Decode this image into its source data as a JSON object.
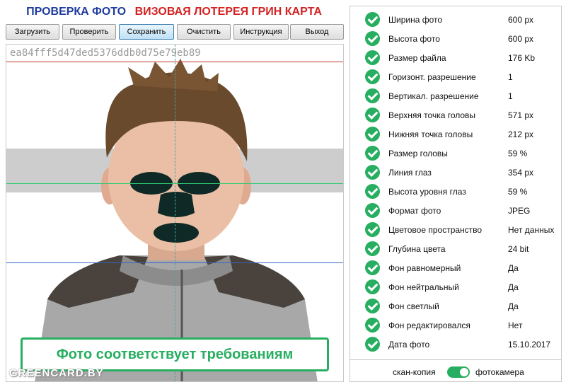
{
  "header": {
    "title_left": "ПРОВЕРКА ФОТО",
    "title_right": "ВИЗОВАЯ ЛОТЕРЕЯ ГРИН КАРТА",
    "colors": {
      "title_left": "#1f3c9e",
      "title_right": "#d32222"
    }
  },
  "toolbar": {
    "buttons": [
      {
        "label": "Загрузить"
      },
      {
        "label": "Проверить"
      },
      {
        "label": "Сохранить",
        "active": true
      },
      {
        "label": "Очистить"
      },
      {
        "label": "Инструкция"
      },
      {
        "label": "Выход"
      }
    ]
  },
  "photo": {
    "hash": "ea84fff5d47ded5376ddb0d75e79eb89",
    "status": "Фото соответствует требованиям",
    "watermark": "GREENCARD.BY",
    "colors": {
      "status": "#27ae60"
    }
  },
  "info": {
    "items": [
      {
        "label": "Ширина фото",
        "value": "600 px"
      },
      {
        "label": "Высота фото",
        "value": "600 px"
      },
      {
        "label": "Размер файла",
        "value": "176 Kb"
      },
      {
        "label": "Горизонт. разрешение",
        "value": "1"
      },
      {
        "label": "Вертикал. разрешение",
        "value": "1"
      },
      {
        "label": "Верхняя точка головы",
        "value": "571 px"
      },
      {
        "label": "Нижняя точка головы",
        "value": "212 px"
      },
      {
        "label": "Размер головы",
        "value": "59 %"
      },
      {
        "label": "Линия глаз",
        "value": "354 px"
      },
      {
        "label": "Высота уровня глаз",
        "value": "59 %"
      },
      {
        "label": "Формат фото",
        "value": "JPEG"
      },
      {
        "label": "Цветовое пространство",
        "value": "Нет данных"
      },
      {
        "label": "Глубина цвета",
        "value": "24 bit"
      },
      {
        "label": "Фон равномерный",
        "value": "Да"
      },
      {
        "label": "Фон нейтральный",
        "value": "Да"
      },
      {
        "label": "Фон светлый",
        "value": "Да"
      },
      {
        "label": "Фон редактировался",
        "value": "Нет"
      },
      {
        "label": "Дата фото",
        "value": "15.10.2017"
      }
    ],
    "check_icon": "check-circle-icon",
    "colors": {
      "check": "#27ae60"
    }
  },
  "toggle": {
    "left_label": "скан-копия",
    "right_label": "фотокамера",
    "state": "фотокамера"
  }
}
